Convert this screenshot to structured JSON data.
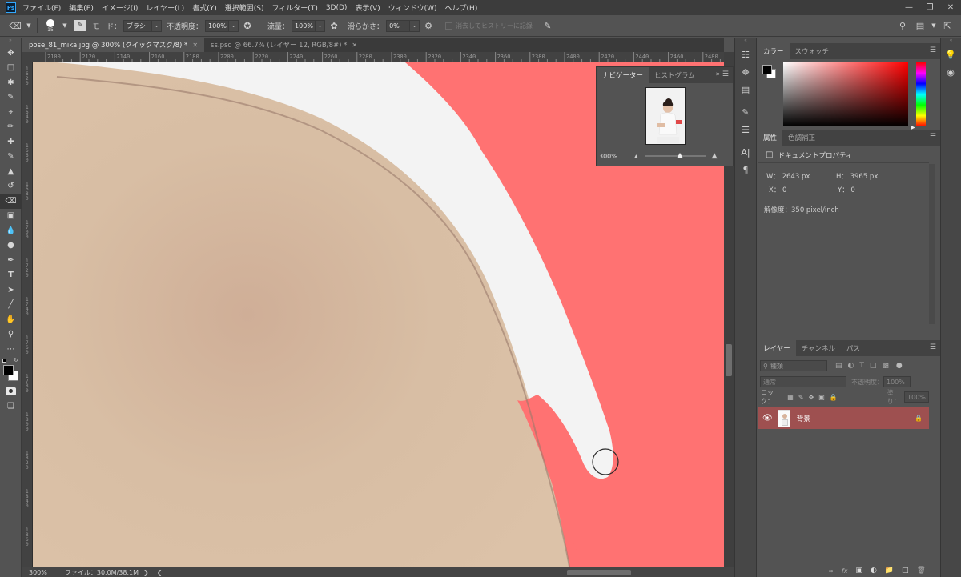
{
  "app": {
    "logo": "Ps"
  },
  "menu": [
    "ファイル(F)",
    "編集(E)",
    "イメージ(I)",
    "レイヤー(L)",
    "書式(Y)",
    "選択範囲(S)",
    "フィルター(T)",
    "3D(D)",
    "表示(V)",
    "ウィンドウ(W)",
    "ヘルプ(H)"
  ],
  "options": {
    "brush_size": "15",
    "mode_label": "モード：",
    "mode_value": "ブラシ",
    "opacity_label": "不透明度：",
    "opacity_value": "100%",
    "flow_label": "流量：",
    "flow_value": "100%",
    "smoothing_label": "滑らかさ：",
    "smoothing_value": "0%",
    "erase_history_label": "消去してヒストリーに記録"
  },
  "tabs": [
    {
      "label": "pose_81_mika.jpg @ 300% (クイックマスク/8) *",
      "active": true
    },
    {
      "label": "ss.psd @ 66.7% (レイヤー 12, RGB/8#) *",
      "active": false
    }
  ],
  "ruler": {
    "top": [
      "2100",
      "2120",
      "2140",
      "2160",
      "2180",
      "2200",
      "2220",
      "2240",
      "2260",
      "2280",
      "2300",
      "2320",
      "2340",
      "2360",
      "2380",
      "2400",
      "2420",
      "2440",
      "2460",
      "2480"
    ],
    "left": [
      "1620",
      "1640",
      "1660",
      "1680",
      "1700",
      "1720",
      "1740",
      "1760",
      "1780",
      "1800",
      "1820",
      "1840",
      "1860"
    ]
  },
  "status": {
    "zoom": "300%",
    "file_info": "ファイル：30.0M/38.1M"
  },
  "navigator": {
    "tabs": [
      "ナビゲーター",
      "ヒストグラム"
    ],
    "zoom": "300%"
  },
  "color_panel": {
    "tabs": [
      "カラー",
      "スウォッチ"
    ],
    "foreground": "#000000",
    "background": "#ffffff"
  },
  "properties": {
    "tabs": [
      "属性",
      "色調補正"
    ],
    "title": "ドキュメントプロパティ",
    "w": "W： 2643 px",
    "h": "H： 3965 px",
    "x": "X： 0",
    "y": "Y： 0",
    "resolution": "解像度：350 pixel/inch"
  },
  "layers": {
    "tabs": [
      "レイヤー",
      "チャンネル",
      "パス"
    ],
    "filter_placeholder": "種類",
    "blend_mode": "通常",
    "opacity_label": "不透明度：",
    "opacity_value": "100%",
    "lock_label": "ロック：",
    "fill_label": "塗り：",
    "fill_value": "100%",
    "items": [
      {
        "name": "背景",
        "visible": true,
        "locked": true
      }
    ]
  },
  "colors": {
    "quickmask": "#ff7272",
    "skin": "#d9bda2",
    "white_garment": "#f3f3f3",
    "layer_selected": "#9e5050"
  }
}
